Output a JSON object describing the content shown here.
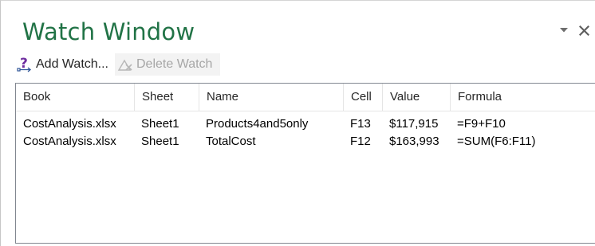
{
  "pane": {
    "title": "Watch Window",
    "options_icon": "chevron-down-icon",
    "close_icon": "close-icon"
  },
  "toolbar": {
    "add_watch_label": "Add Watch...",
    "add_watch_icon": "add-watch-icon",
    "delete_watch_label": "Delete Watch",
    "delete_watch_icon": "delete-watch-icon",
    "delete_watch_enabled": false
  },
  "list": {
    "columns": [
      "Book",
      "Sheet",
      "Name",
      "Cell",
      "Value",
      "Formula"
    ],
    "rows": [
      {
        "book": "CostAnalysis.xlsx",
        "sheet": "Sheet1",
        "name": "Products4and5only",
        "cell": "F13",
        "value": "$117,915",
        "formula": "=F9+F10"
      },
      {
        "book": "CostAnalysis.xlsx",
        "sheet": "Sheet1",
        "name": "TotalCost",
        "cell": "F12",
        "value": "$163,993",
        "formula": "=SUM(F6:F11)"
      }
    ]
  },
  "colors": {
    "title": "#217346",
    "text": "#262626",
    "disabled_text": "#a6a6a6",
    "list_border": "#828790"
  }
}
